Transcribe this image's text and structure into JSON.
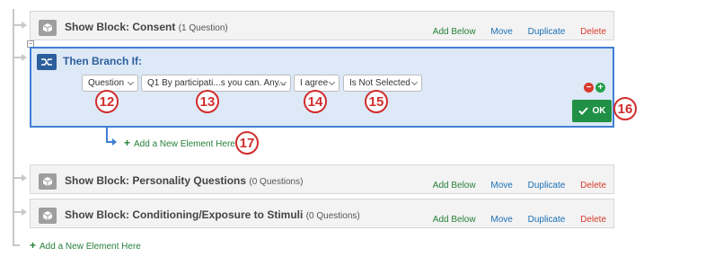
{
  "blocks": [
    {
      "title": "Show Block: Consent",
      "count": "(1 Question)"
    },
    {
      "title": "Show Block: Personality Questions",
      "count": "(0 Questions)"
    },
    {
      "title": "Show Block: Conditioning/Exposure to Stimuli",
      "count": "(0 Questions)"
    }
  ],
  "actions": {
    "add_below": "Add Below",
    "move": "Move",
    "duplicate": "Duplicate",
    "delete": "Delete"
  },
  "branch": {
    "title": "Then Branch If:",
    "question_dropdown": "Question",
    "question_select": "Q1 By participati...s you can. Any...",
    "answer_select": "I agree",
    "operator_select": "Is Not Selected",
    "ok_label": "OK",
    "remove_symbol": "−",
    "add_symbol": "+"
  },
  "add_element": {
    "label": "Add a New Element Here"
  },
  "annotations": [
    "12",
    "13",
    "14",
    "15",
    "16",
    "17"
  ],
  "colors": {
    "branch_border": "#3f7fd4",
    "ok_green": "#1f9045",
    "badge_red": "#d12d2d"
  }
}
